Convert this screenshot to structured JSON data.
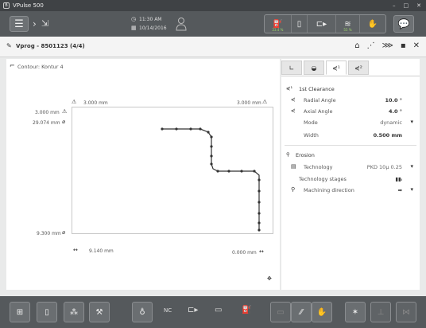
{
  "app": {
    "title": "VPulse 500"
  },
  "topbar": {
    "time": "11:30 AM",
    "date": "10/14/2016",
    "status": {
      "left_pct": "23.4 %",
      "right_pct": "55 %"
    }
  },
  "header": {
    "program_title": "Vprog - 8501123 (4/4)"
  },
  "left": {
    "contour_label": "Contour: Kontur 4",
    "dims": {
      "top_left": "3.000 mm",
      "top_right": "3.000 mm",
      "left_top": "3.000 mm",
      "left_dia": "29.074 mm",
      "left_bottom": "9.300 mm",
      "bottom_left": "9.140 mm",
      "bottom_right": "0.000 mm"
    }
  },
  "right": {
    "section1_title": "1st Clearance",
    "radial_label": "Radial Angle",
    "radial_value": "10.0 °",
    "axial_label": "Axial Angle",
    "axial_value": "4.0 °",
    "mode_label": "Mode",
    "mode_value": "dynamic",
    "width_label": "Width",
    "width_value": "0.500 mm",
    "section2_title": "Erosion",
    "technology_label": "Technology",
    "technology_value": "PKD 10µ 0.25",
    "tech_stages_label": "Technology stages",
    "machining_dir_label": "Machining direction"
  },
  "bottombar": {
    "nc_label": "NC"
  },
  "colors": {
    "toolbar": "#55595c",
    "panel": "#ffffff",
    "accent_green": "#9fd86b"
  }
}
